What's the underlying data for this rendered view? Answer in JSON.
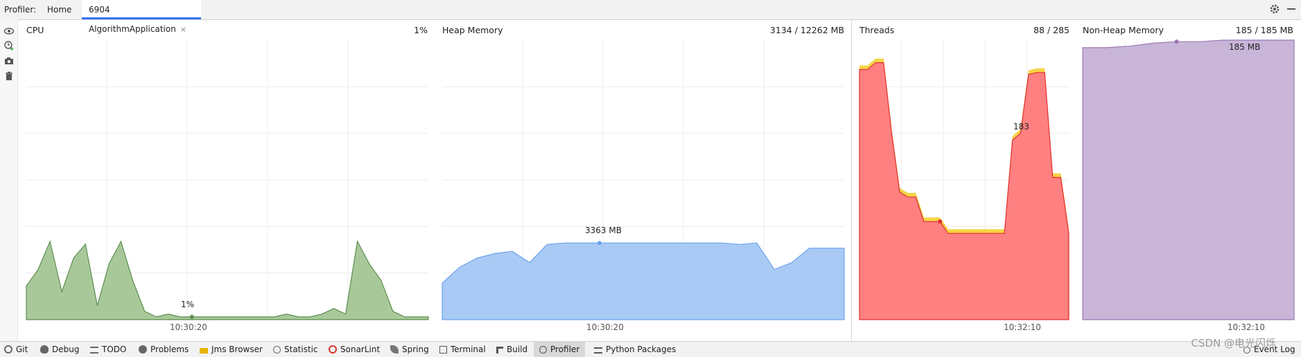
{
  "header": {
    "label": "Profiler:",
    "tabs": [
      {
        "label": "Home"
      },
      {
        "label": "6904 AlgorithmApplication",
        "close": "×"
      }
    ]
  },
  "panels": {
    "cpu": {
      "title": "CPU",
      "value": "1%",
      "annotation": "1%",
      "time": "10:30:20",
      "color": "#5a8f4e"
    },
    "heap": {
      "title": "Heap Memory",
      "value": "3134 / 12262 MB",
      "annotation": "3363 MB",
      "time": "10:30:20",
      "color": "#6ba3ec"
    },
    "threads": {
      "title": "Threads",
      "value": "88 / 285",
      "annotation": "183",
      "time": "10:32:10",
      "color": "#ff7c7c"
    },
    "nonheap": {
      "title": "Non-Heap Memory",
      "value": "185 / 185 MB",
      "annotation": "185 MB",
      "time": "10:32:10",
      "color": "#b39ac6"
    }
  },
  "bottom": {
    "items": [
      {
        "label": "Git",
        "icon": "git-icon"
      },
      {
        "label": "Debug",
        "icon": "bug-icon"
      },
      {
        "label": "TODO",
        "icon": "list-icon"
      },
      {
        "label": "Problems",
        "icon": "info-icon"
      },
      {
        "label": "Jms Browser",
        "icon": "jms-icon"
      },
      {
        "label": "Statistic",
        "icon": "pie-icon"
      },
      {
        "label": "SonarLint",
        "icon": "sonar-icon"
      },
      {
        "label": "Spring",
        "icon": "leaf-icon"
      },
      {
        "label": "Terminal",
        "icon": "terminal-icon"
      },
      {
        "label": "Build",
        "icon": "hammer-icon"
      },
      {
        "label": "Profiler",
        "icon": "profiler-icon"
      },
      {
        "label": "Python Packages",
        "icon": "layers-icon"
      }
    ],
    "event_log": "Event Log"
  },
  "watermark": "CSDN @电光闪烁",
  "chart_data": [
    {
      "type": "area",
      "title": "CPU",
      "ylabel": "",
      "ylim": [
        0,
        100
      ],
      "x": [
        "",
        "",
        "10:30:20",
        "",
        ""
      ],
      "series": [
        {
          "values": [
            12,
            18,
            28,
            10,
            22,
            27,
            5,
            20,
            28,
            14,
            3,
            1,
            2,
            1,
            1,
            1,
            1,
            1,
            1,
            1,
            1,
            1,
            2,
            1,
            1,
            2,
            4,
            2,
            28,
            20,
            14,
            3,
            1,
            1,
            1
          ]
        }
      ]
    },
    {
      "type": "area",
      "title": "Heap Memory",
      "ylabel": "",
      "ylim": [
        0,
        12262
      ],
      "x": [
        "",
        "",
        "10:30:20",
        "",
        ""
      ],
      "series": [
        {
          "values": [
            1600,
            2300,
            2700,
            2900,
            3000,
            2500,
            3300,
            3363,
            3363,
            3363,
            3363,
            3363,
            3363,
            3363,
            3363,
            3363,
            3363,
            3300,
            3363,
            2200,
            2500,
            3134,
            3134,
            3134
          ]
        }
      ]
    },
    {
      "type": "area",
      "title": "Threads",
      "ylabel": "",
      "ylim": [
        0,
        285
      ],
      "x": [
        "",
        "",
        "10:32:10",
        "",
        ""
      ],
      "series": [
        {
          "values": [
            255,
            255,
            262,
            262,
            190,
            130,
            125,
            125,
            100,
            100,
            100,
            88,
            88,
            88,
            88,
            88,
            88,
            88,
            88,
            183,
            190,
            250,
            252,
            252,
            145,
            145,
            88
          ]
        }
      ]
    },
    {
      "type": "area",
      "title": "Non-Heap Memory",
      "ylabel": "",
      "ylim": [
        0,
        185
      ],
      "x": [
        "",
        "",
        "10:32:10",
        "",
        ""
      ],
      "series": [
        {
          "values": [
            180,
            180,
            181,
            183,
            184,
            184,
            185,
            185,
            185,
            185
          ]
        }
      ]
    }
  ]
}
